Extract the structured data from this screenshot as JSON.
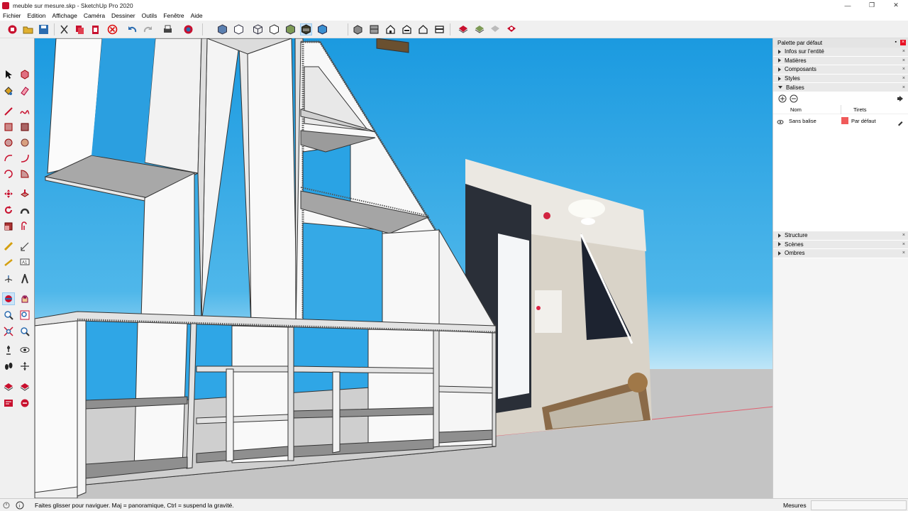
{
  "window": {
    "title": "meuble sur mesure.skp - SketchUp Pro 2020",
    "controls": [
      "—",
      "❐",
      "✕"
    ]
  },
  "menu": [
    "Fichier",
    "Edition",
    "Affichage",
    "Caméra",
    "Dessiner",
    "Outils",
    "Fenêtre",
    "Aide"
  ],
  "tray": {
    "title": "Palette par défaut",
    "panels_top": [
      {
        "label": "Infos sur l'entité",
        "expanded": false
      },
      {
        "label": "Matières",
        "expanded": false
      },
      {
        "label": "Composants",
        "expanded": false
      },
      {
        "label": "Styles",
        "expanded": false
      },
      {
        "label": "Balises",
        "expanded": true
      }
    ],
    "tags": {
      "col_name": "Nom",
      "col_dashes": "Tirets",
      "rows": [
        {
          "name": "Sans balise",
          "color": "#f05a5a",
          "dash": "Par défaut"
        }
      ]
    },
    "panels_bottom": [
      {
        "label": "Structure"
      },
      {
        "label": "Scènes"
      },
      {
        "label": "Ombres"
      }
    ]
  },
  "status": {
    "hint": "Faites glisser pour naviguer. Maj = panoramique, Ctrl = suspend la gravité.",
    "measure_label": "Mesures",
    "measure_value": ""
  }
}
